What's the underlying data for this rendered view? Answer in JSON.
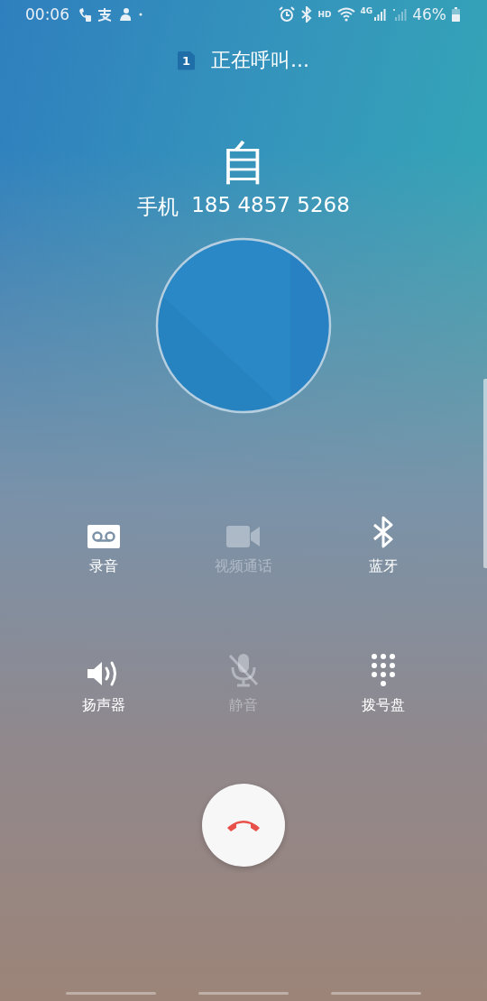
{
  "status_bar": {
    "time": "00:06",
    "hd": "HD",
    "network": "4G",
    "battery": "46%"
  },
  "call": {
    "sim_badge": "1",
    "status": "正在呼叫...",
    "name": "自",
    "number_label": "手机",
    "number": "185 4857 5268"
  },
  "actions": [
    {
      "kind": "record",
      "label": "录音",
      "disabled": false
    },
    {
      "kind": "video",
      "label": "视频通话",
      "disabled": true
    },
    {
      "kind": "bluetooth",
      "label": "蓝牙",
      "disabled": false
    },
    {
      "kind": "speaker",
      "label": "扬声器",
      "disabled": false
    },
    {
      "kind": "mute",
      "label": "静音",
      "disabled": true
    },
    {
      "kind": "keypad",
      "label": "拨号盘",
      "disabled": false
    }
  ]
}
